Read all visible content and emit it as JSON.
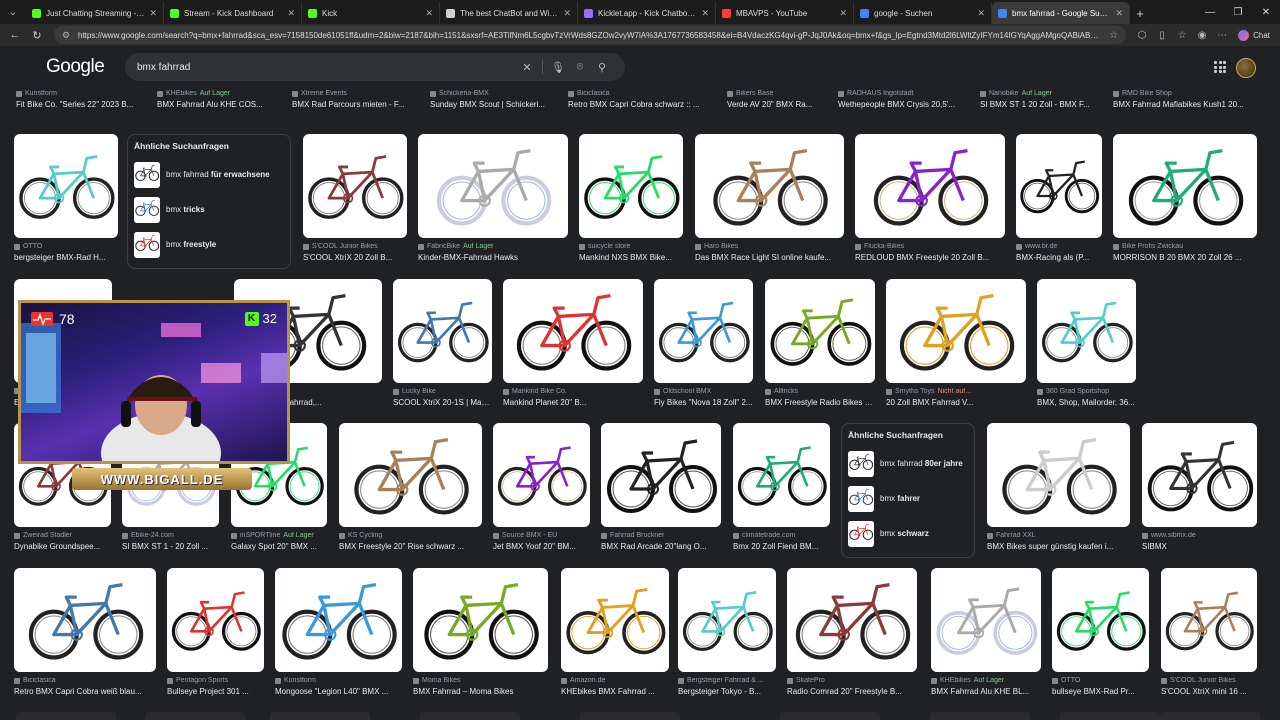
{
  "browser": {
    "tabs": [
      {
        "label": "Just Chatting Streaming - Live Stre",
        "color": "#53fc18"
      },
      {
        "label": "Stream - Kick Dashboard",
        "color": "#53fc18"
      },
      {
        "label": "Kick",
        "color": "#53fc18"
      },
      {
        "label": "The best ChatBot and Widgets for",
        "color": "#d0d0d0"
      },
      {
        "label": "Kicklet.app - Kick Chatbot and Ov",
        "color": "#9c6cf6"
      },
      {
        "label": "MBAVPS - YouTube",
        "color": "#ff3b3b"
      },
      {
        "label": "google - Suchen",
        "color": "#4285f4"
      },
      {
        "label": "bmx fahrrad - Google Suche",
        "color": "#4285f4"
      }
    ],
    "url": "https://www.google.com/search?q=bmx+fahrrad&sca_esv=7158150de61051ff&udm=2&biw=2187&bih=1151&sxsrf=AE3TifNm6L5cgbvTzVrWds8GZOw2vyW7iA%3A1767736583458&ei=B4VdaczKG4qvi-gP-JqJ0Ak&oq=bmx+f&gs_lp=Egtnd3Mtd2l6LWltZyIFYm14IGYqAggAMgoQABiABBhDGIoF...",
    "chat_label": "Chat"
  },
  "google": {
    "logo": "Google",
    "query": "bmx fahrrad"
  },
  "row0": [
    {
      "src": "Kunstform",
      "title": "Fit Bike Co. \"Series 22\" 2023 B..."
    },
    {
      "src": "KHEbikes",
      "stock": "Auf Lager",
      "title": "BMX Fahrrad Alu KHE COS..."
    },
    {
      "src": "Xtreme Events",
      "title": "BMX Rad Parcours mieten - F..."
    },
    {
      "src": "Schickeria-BMX",
      "title": "Sunday BMX Scout | Schickeri..."
    },
    {
      "src": "Biciclasica",
      "title": "Retro BMX Capri Cobra schwarz :: ..."
    },
    {
      "src": "Bikers Base",
      "title": "Verde AV 20\" BMX Ra..."
    },
    {
      "src": "RADHAUS Ingolstadt",
      "title": "Wethepeople BMX Crysis 20,5'..."
    },
    {
      "src": "Nanobike",
      "stock": "Auf Lager",
      "title": "SI BMX ST 1 20 Zoll - BMX F..."
    },
    {
      "src": "RMD Bike Shop",
      "title": "BMX Fahrrad Mafiabikes Kush1 20..."
    }
  ],
  "related1": {
    "heading": "Ähnliche Suchanfragen",
    "items": [
      {
        "base": "bmx fahrrad ",
        "bold": "für erwachsene"
      },
      {
        "base": "bmx ",
        "bold": "tricks"
      },
      {
        "base": "bmx ",
        "bold": "freestyle"
      }
    ]
  },
  "related2": {
    "heading": "Ähnliche Suchanfragen",
    "items": [
      {
        "base": "bmx fahrrad ",
        "bold": "80er jahre"
      },
      {
        "base": "bmx ",
        "bold": "fahrer"
      },
      {
        "base": "bmx ",
        "bold": "schwarz"
      }
    ]
  },
  "row1": [
    {
      "src": "OTTO",
      "title": "bergsteiger BMX-Rad H..."
    },
    {
      "src": "S'COOL Junior Bikes",
      "title": "S'COOL XtriX 20 Zoll B..."
    },
    {
      "src": "FabricBike",
      "stock": "Auf Lager",
      "title": "Kinder-BMX-Fahrrad Hawks"
    },
    {
      "src": "suicycle store",
      "title": "Mankind NXS BMX Bike..."
    },
    {
      "src": "Haro Bikes",
      "title": "Das BMX Race Light SI online kaufe..."
    },
    {
      "src": "Flucka-Bikes",
      "title": "REDLOUD BMX Freestyle 20 Zoll B..."
    },
    {
      "src": "www.br.de",
      "title": "BMX-Racing als (P..."
    },
    {
      "src": "Bike Profis Zwickau",
      "title": "MORRISON B 20 BMX 20 Zoll 26 ..."
    }
  ],
  "row2": [
    {
      "src": "",
      "title": "E Thrillseeker BMX ..."
    },
    {
      "src": "VEVOR DE",
      "title": "VEVOR Kinderfahrrad,..."
    },
    {
      "src": "Lucky Bike",
      "title": "SCOOL XtriX 20-1S | Markenräde..."
    },
    {
      "src": "Mankind Bike Co.",
      "title": "Mankind Planet 20\" B..."
    },
    {
      "src": "Oldschool BMX",
      "title": "Fly Bikes \"Nova 18 Zoll\" 2..."
    },
    {
      "src": "Alltricks",
      "title": "BMX Freestyle Radio Bikes Evol ..."
    },
    {
      "src": "Smyths Toys",
      "nostock": "Nicht auf...",
      "title": "20 Zoll BMX Fahrrad V..."
    },
    {
      "src": "360 Grad Sportshop",
      "title": "BMX, Shop, Mailorder, 36..."
    }
  ],
  "row3": [
    {
      "src": "Zweirad Stadler",
      "title": "Dynabike Groundspee..."
    },
    {
      "src": "Ebike-24.com",
      "title": "SI BMX ST 1 - 20 Zoll ..."
    },
    {
      "src": "inSPORTline",
      "stock": "Auf Lager",
      "title": "Galaxy Spot 20\" BMX ..."
    },
    {
      "src": "KS Cycling",
      "title": "BMX Freestyle 20\" Rise schwarz ..."
    },
    {
      "src": "Source BMX - EU",
      "title": "Jet BMX Yoof 20\" BM..."
    },
    {
      "src": "Fahrrad Bruckner",
      "title": "BMX Rad Arcade 20\"lang O..."
    },
    {
      "src": "climatetrade.com",
      "title": "Bmx 20 Zoll Fiend BM..."
    },
    {
      "src": "Fahrrad XXL",
      "title": "BMX Bikes super günstig kaufen i..."
    },
    {
      "src": "www.sibmx.de",
      "title": "SIBMX"
    }
  ],
  "row4": [
    {
      "src": "Biciclasica",
      "title": "Retro BMX Capri Cobra weiß blau..."
    },
    {
      "src": "Pentagon Sports",
      "title": "Bullseye Project 301 ..."
    },
    {
      "src": "Kunstform",
      "title": "Mongoose \"Legion L40\" BMX ..."
    },
    {
      "src": "Moma Bikes",
      "title": "BMX Fahrrad – Moma Bikes"
    },
    {
      "src": "Amazon.de",
      "title": "KHEbikes BMX Fahrrad ..."
    },
    {
      "src": "Bergsteiger Fahrrad & ...",
      "title": "Bergsteiger Tokyo - B..."
    },
    {
      "src": "SkatePro",
      "title": "Radio Comrad 20\" Freestyle B..."
    },
    {
      "src": "KHEbikes",
      "stock": "Auf Lager",
      "title": "BMX Fahrrad Alu KHE BL..."
    },
    {
      "src": "OTTO",
      "title": "bullseye BMX-Rad Pr..."
    },
    {
      "src": "S'COOL Junior Bikes",
      "title": "S'COOL XtriX mini 16 ..."
    }
  ],
  "webcam": {
    "heart_rate": "78",
    "kick_count": "32",
    "banner": "WWW.BIGALL.DE"
  }
}
